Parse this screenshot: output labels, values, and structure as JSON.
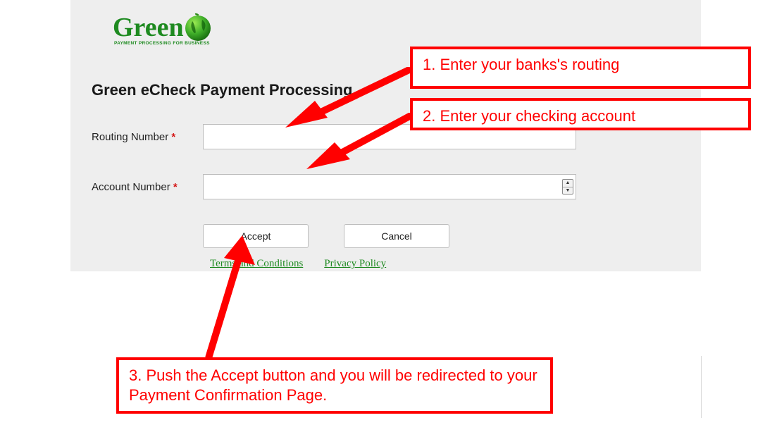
{
  "brand": {
    "name": "Green",
    "tagline": "PAYMENT PROCESSING FOR BUSINESS",
    "color": "#1e8a20"
  },
  "heading": "Green eCheck Payment Processing.",
  "routing": {
    "label": "Routing Number",
    "required_mark": "*",
    "value": ""
  },
  "account": {
    "label": "Account Number",
    "required_mark": "*",
    "value": ""
  },
  "buttons": {
    "accept": "Accept",
    "cancel": "Cancel"
  },
  "links": {
    "terms": "Terms and Conditions ",
    "privacy": "Privacy Policy "
  },
  "callouts": {
    "c1": "1. Enter your banks's routing",
    "c2": "2. Enter your checking account",
    "c3": "3. Push the Accept button and you will be redirected to your Payment Confirmation Page."
  },
  "colors": {
    "annotation": "#ff0000",
    "panel_bg": "#eeeeee"
  }
}
